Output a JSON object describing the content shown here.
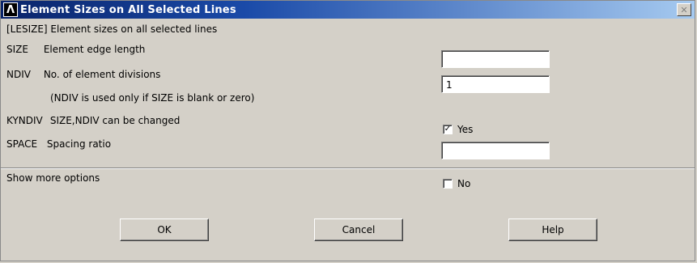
{
  "window": {
    "title": "Element Sizes on All Selected Lines",
    "close_glyph": "✕",
    "logo_glyph": "Λ"
  },
  "header_text": "[LESIZE]  Element sizes on all selected lines",
  "fields": {
    "size": {
      "code": "SIZE",
      "label": "Element edge length",
      "value": ""
    },
    "ndiv": {
      "code": "NDIV",
      "label": "No. of element divisions",
      "value": "1"
    },
    "ndiv_note": "(NDIV is used only if SIZE is blank or zero)",
    "kyndiv": {
      "code": "KYNDIV",
      "label": "SIZE,NDIV can be changed",
      "checked": true,
      "check_glyph": "✓",
      "option_label": "Yes"
    },
    "space": {
      "code": "SPACE",
      "label": "Spacing ratio",
      "value": ""
    }
  },
  "more_options": {
    "label": "Show more options",
    "checked": false,
    "option_label": "No"
  },
  "buttons": {
    "ok": "OK",
    "cancel": "Cancel",
    "help": "Help"
  },
  "colors": {
    "title_start": "#0a246a",
    "title_end": "#a6caf0",
    "face": "#d4d0c8"
  }
}
